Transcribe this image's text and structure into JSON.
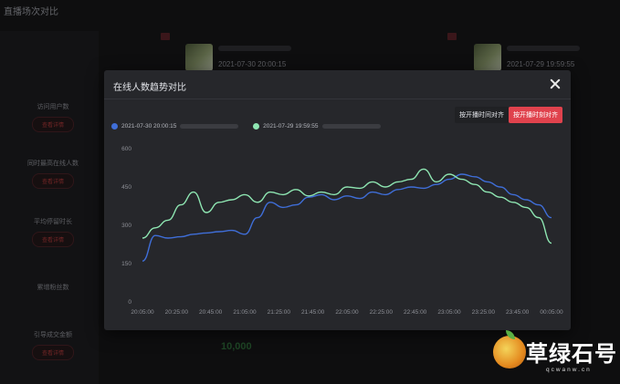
{
  "page": {
    "title": "直播场次对比"
  },
  "left_metrics": [
    {
      "label": "访问用户数",
      "action": "查看详情"
    },
    {
      "label": "同时最高在线人数",
      "action": "查看详情"
    },
    {
      "label": "平均停留时长",
      "action": "查看详情"
    },
    {
      "label": "累增粉丝数",
      "action": ""
    },
    {
      "label": "引导成交金额",
      "action": "查看详情"
    }
  ],
  "sessions": [
    {
      "time": "2021-07-30 20:00:15"
    },
    {
      "time": "2021-07-29 19:59:55"
    }
  ],
  "background_value": "10,000",
  "modal": {
    "title": "在线人数趋势对比",
    "btn_align_wall": "按开播时间对齐",
    "btn_align_rel": "按开播时刻对齐",
    "legend": [
      {
        "label": "2021-07-30 20:00:15",
        "color": "#3f6ed8"
      },
      {
        "label": "2021-07-29 19:59:55",
        "color": "#8ee6b2"
      }
    ]
  },
  "chart_data": {
    "type": "line",
    "x": [
      "20:05:00",
      "20:25:00",
      "20:45:00",
      "21:05:00",
      "21:25:00",
      "21:45:00",
      "22:05:00",
      "22:25:00",
      "22:45:00",
      "23:05:00",
      "23:25:00",
      "23:45:00",
      "00:05:00"
    ],
    "yticks": [
      "0",
      "150",
      "300",
      "450",
      "600"
    ],
    "ylim": [
      0,
      600
    ],
    "grid": false,
    "series": [
      {
        "name": "2021-07-30 20:00:15",
        "color": "#3f6ed8",
        "values": [
          160,
          260,
          250,
          255,
          265,
          270,
          275,
          280,
          265,
          330,
          390,
          370,
          380,
          410,
          420,
          400,
          415,
          405,
          430,
          420,
          440,
          450,
          445,
          460,
          480,
          500,
          490,
          470,
          450,
          420,
          400,
          380,
          330
        ]
      },
      {
        "name": "2021-07-29 19:59:55",
        "color": "#8ee6b2",
        "values": [
          250,
          290,
          320,
          380,
          430,
          350,
          390,
          400,
          420,
          390,
          430,
          420,
          440,
          415,
          430,
          420,
          450,
          445,
          470,
          450,
          470,
          480,
          520,
          470,
          500,
          480,
          460,
          430,
          410,
          390,
          370,
          330,
          230
        ]
      }
    ]
  }
}
